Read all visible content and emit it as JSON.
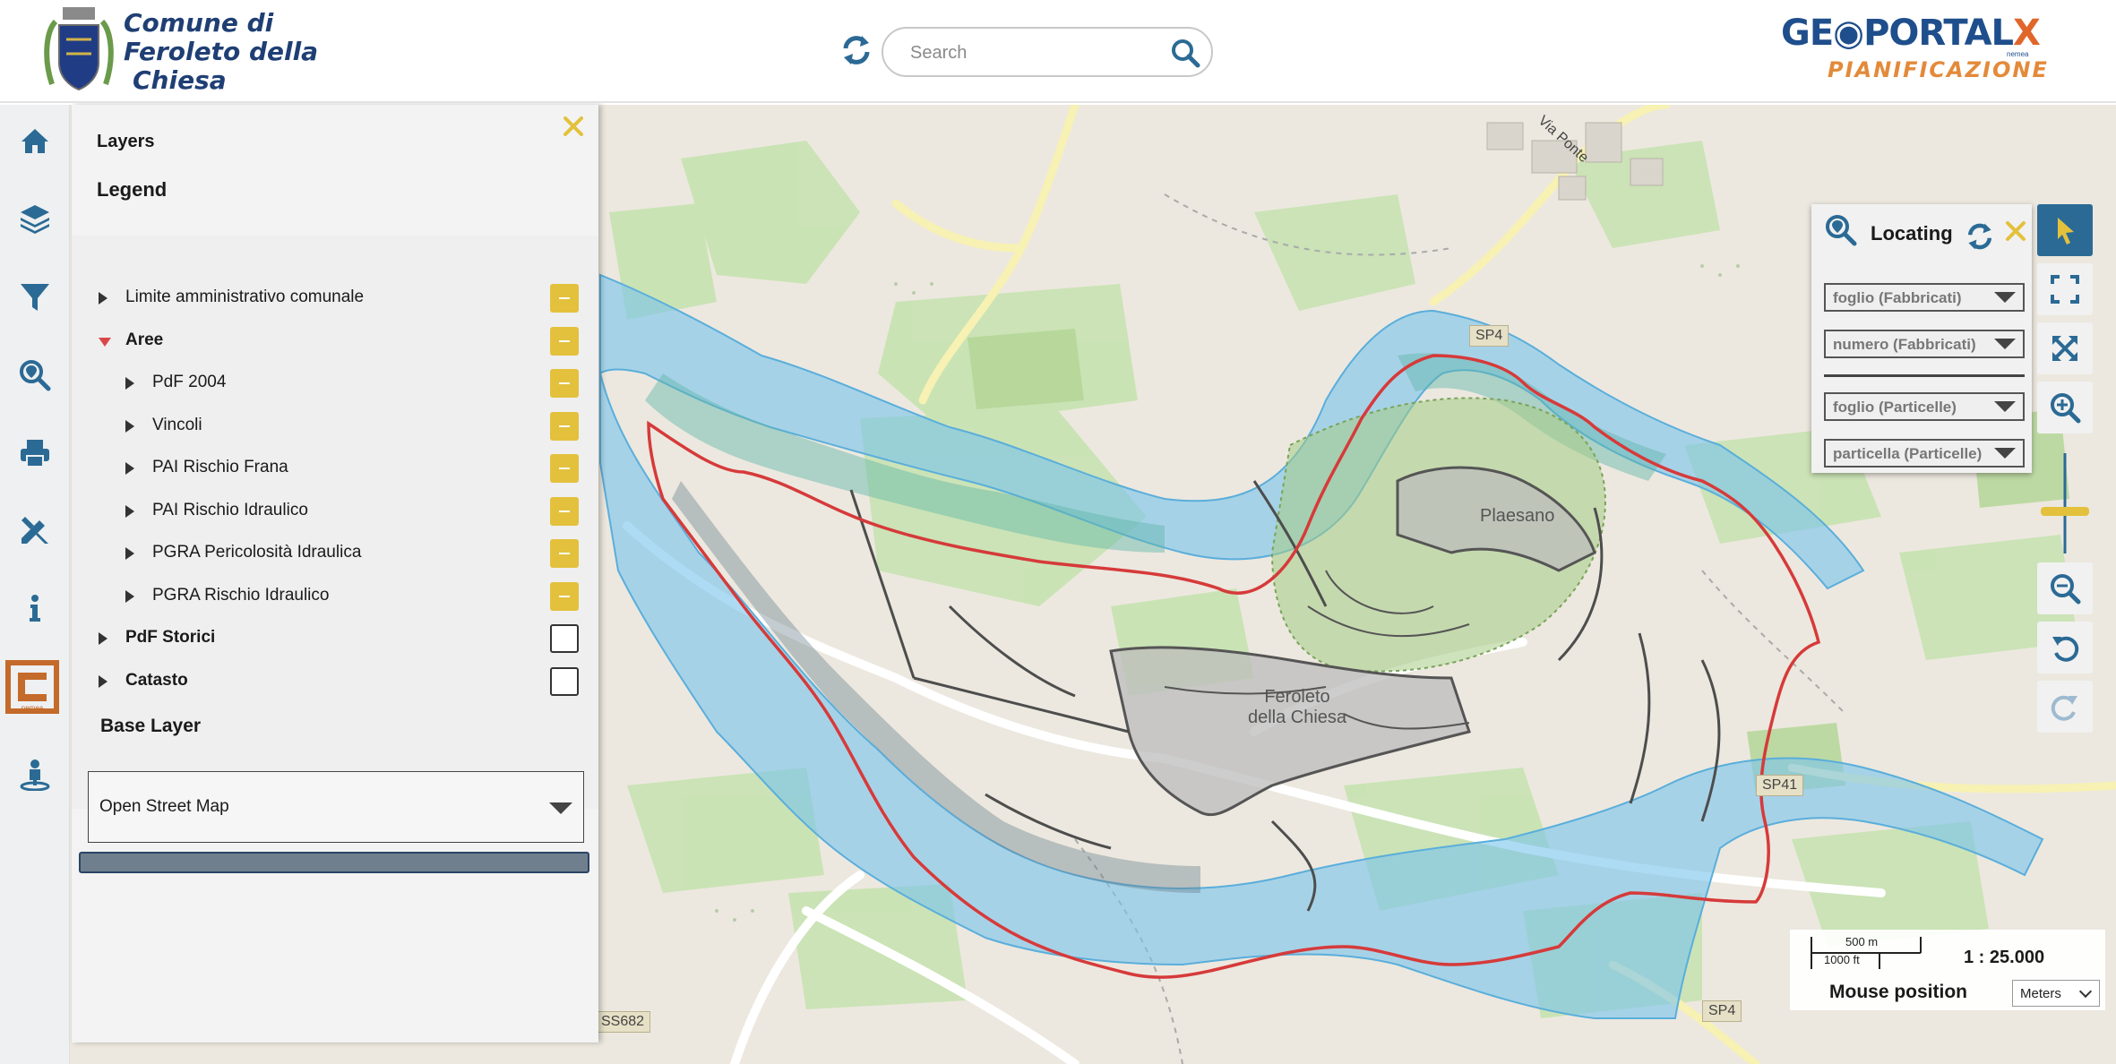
{
  "header": {
    "municipality_line1": "Comune di",
    "municipality_line2": "Feroleto della",
    "municipality_line3": "Chiesa",
    "search_placeholder": "Search",
    "brand_text_left": "GE",
    "brand_text_mid": "PORTAL",
    "brand_text_x": "X",
    "brand_tagline": "nemea",
    "brand_subtitle": "PIANIFICAZIONE"
  },
  "left_toolbar": {
    "icons": [
      "home-icon",
      "layers-icon",
      "filter-icon",
      "locate-search-icon",
      "print-icon",
      "measure-tools-icon",
      "info-icon",
      "nemea-logo-icon",
      "street-view-icon"
    ],
    "nemea_caption": "nemea"
  },
  "layers_panel": {
    "tab_layers": "Layers",
    "tab_legend": "Legend",
    "tree": [
      {
        "label": "Limite amministrativo comunale",
        "level": 0,
        "expanded": false,
        "bold": false,
        "visible": true
      },
      {
        "label": "Aree",
        "level": 0,
        "expanded": true,
        "bold": true,
        "visible": true
      },
      {
        "label": "PdF 2004",
        "level": 1,
        "expanded": false,
        "bold": false,
        "visible": true
      },
      {
        "label": "Vincoli",
        "level": 1,
        "expanded": false,
        "bold": false,
        "visible": true
      },
      {
        "label": "PAI Rischio Frana",
        "level": 1,
        "expanded": false,
        "bold": false,
        "visible": true
      },
      {
        "label": "PAI Rischio Idraulico",
        "level": 1,
        "expanded": false,
        "bold": false,
        "visible": true
      },
      {
        "label": "PGRA Pericolosità Idraulica",
        "level": 1,
        "expanded": false,
        "bold": false,
        "visible": true
      },
      {
        "label": "PGRA Rischio Idraulico",
        "level": 1,
        "expanded": false,
        "bold": false,
        "visible": true
      },
      {
        "label": "PdF Storici",
        "level": 0,
        "expanded": false,
        "bold": true,
        "visible": false
      },
      {
        "label": "Catasto",
        "level": 0,
        "expanded": false,
        "bold": true,
        "visible": false
      }
    ],
    "base_layer_title": "Base Layer",
    "base_layer_value": "Open Street Map"
  },
  "map": {
    "labels": {
      "via_ponte": "Via Ponte",
      "laureana": "Plaesano",
      "feroleto": "Feroleto della Chiesa"
    },
    "road_shields": {
      "sp4_top": "SP4",
      "sp41": "SP41",
      "sp4_bottom": "SP4",
      "ss682": "SS682"
    }
  },
  "locating": {
    "title": "Locating",
    "fields": [
      "foglio (Fabbricati)",
      "numero (Fabbricati)",
      "foglio (Particelle)",
      "particella (Particelle)"
    ]
  },
  "right_toolbar": {
    "icons": [
      "select-pointer-icon",
      "fullscreen-icon",
      "zoom-extent-icon",
      "zoom-in-icon",
      "zoom-out-icon",
      "undo-icon",
      "redo-icon"
    ]
  },
  "scale": {
    "metric": "500 m",
    "imperial": "1000 ft",
    "ratio": "1 : 25.000",
    "mouse_position_label": "Mouse position",
    "units": "Meters"
  },
  "colors": {
    "accent_blue": "#2b6a95",
    "toggle_yellow": "#e3c13d",
    "boundary_red": "#d63a3a",
    "flood_blue": "#7fc4ea",
    "header_blue": "#1f3f74",
    "brand_orange": "#e38a3a"
  }
}
